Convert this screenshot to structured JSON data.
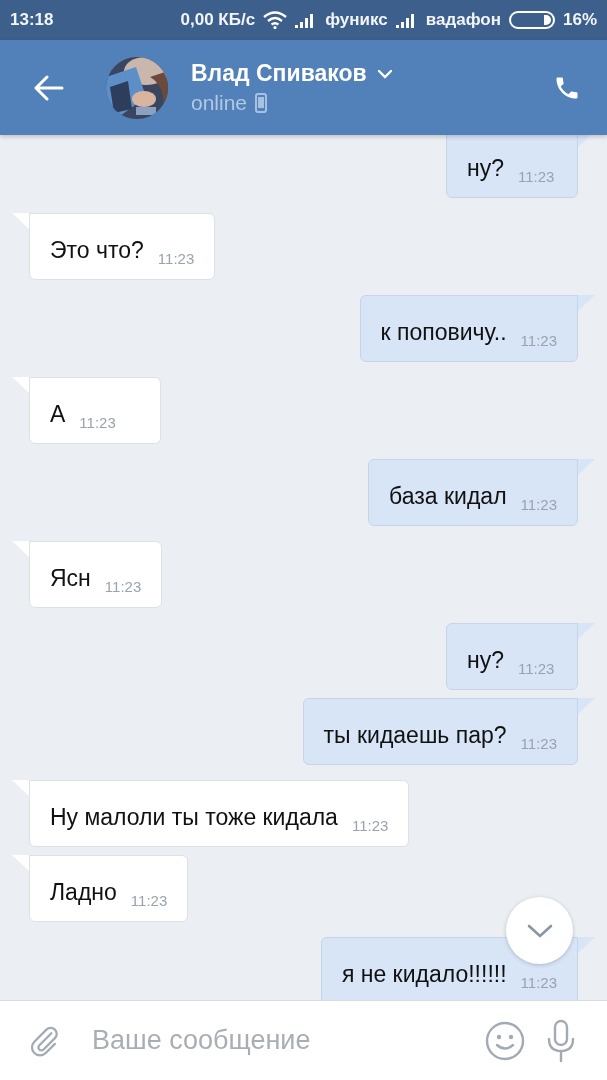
{
  "status_bar": {
    "time": "13:18",
    "speed": "0,00 КБ/с",
    "carrier_1": "фуникс",
    "carrier_2": "вадафон",
    "battery": "16%"
  },
  "header": {
    "name": "Влад Спиваков",
    "status": "online"
  },
  "messages": [
    {
      "kind": "out",
      "text": "ну?",
      "time": "11:23"
    },
    {
      "kind": "in",
      "text": "Это что?",
      "time": "11:23"
    },
    {
      "kind": "out",
      "text": "к поповичу..",
      "time": "11:23"
    },
    {
      "kind": "in",
      "text": "А",
      "time": "11:23"
    },
    {
      "kind": "out",
      "text": "база кидал",
      "time": "11:23"
    },
    {
      "kind": "in",
      "text": "Ясн",
      "time": "11:23"
    },
    {
      "kind": "out",
      "text": "ну?",
      "time": "11:23"
    },
    {
      "kind": "out",
      "text": "ты кидаешь пар?",
      "time": "11:23"
    },
    {
      "kind": "in",
      "text": "Ну малоли ты тоже кидала",
      "time": "11:23"
    },
    {
      "kind": "in",
      "text": "Ладно",
      "time": "11:23"
    },
    {
      "kind": "out",
      "text": "я не кидало!!!!!!",
      "time": "11:23"
    }
  ],
  "composer": {
    "placeholder": "Ваше сообщение"
  }
}
